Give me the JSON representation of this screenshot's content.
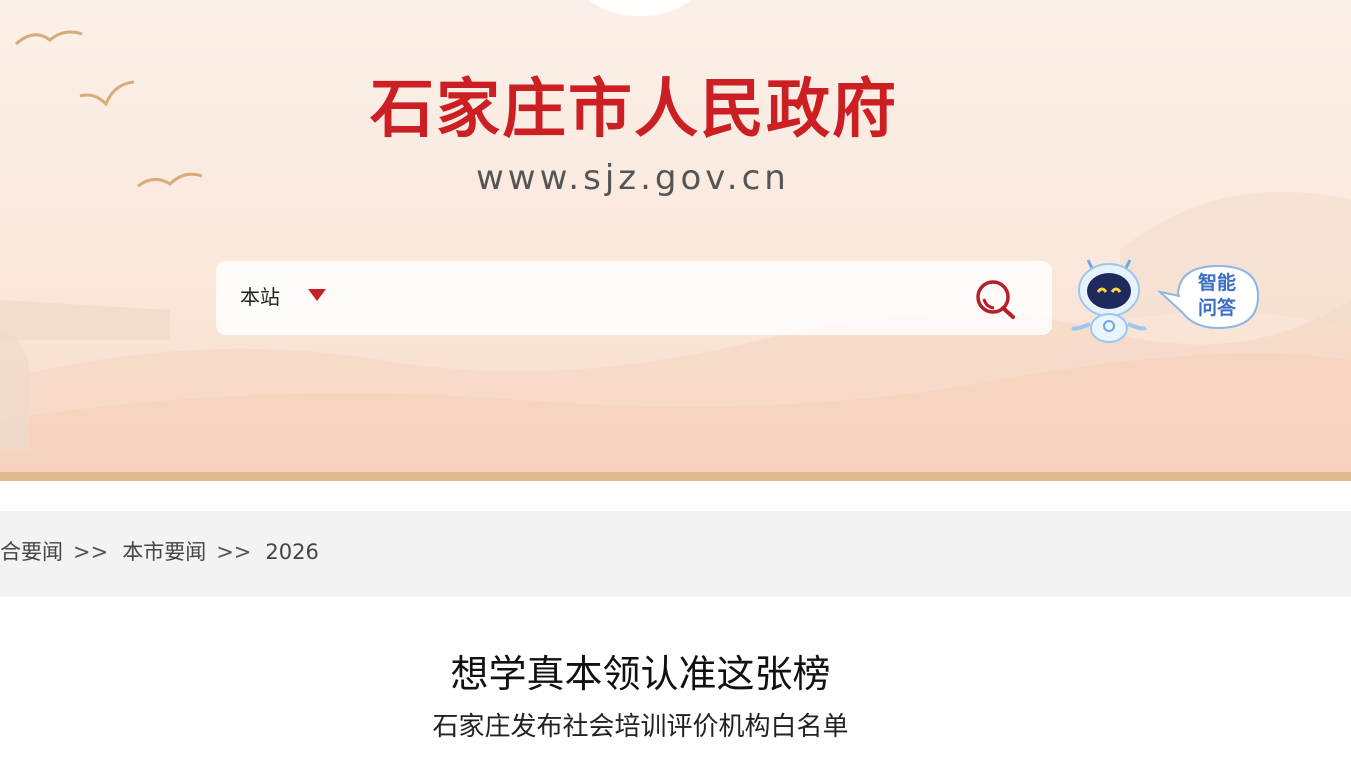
{
  "header": {
    "title": "石家庄市人民政府",
    "url": "www.sjz.gov.cn",
    "title_color": "#cc1f24"
  },
  "search": {
    "scope": "本站",
    "placeholder": "",
    "value": "",
    "accent": "#c81e28"
  },
  "assistant": {
    "line1": "智能",
    "line2": "问答",
    "color": "#3b6fc4"
  },
  "breadcrumb": {
    "items": [
      "合要闻",
      "本市要闻",
      "2026"
    ],
    "separator": ">>"
  },
  "article": {
    "title": "想学真本领认准这张榜",
    "subtitle": "石家庄发布社会培训评价机构白名单"
  },
  "icons": {
    "search": "search-icon",
    "dropdown": "triangle-down-icon",
    "robot": "robot-assistant-icon",
    "birds": "bird-icon"
  }
}
